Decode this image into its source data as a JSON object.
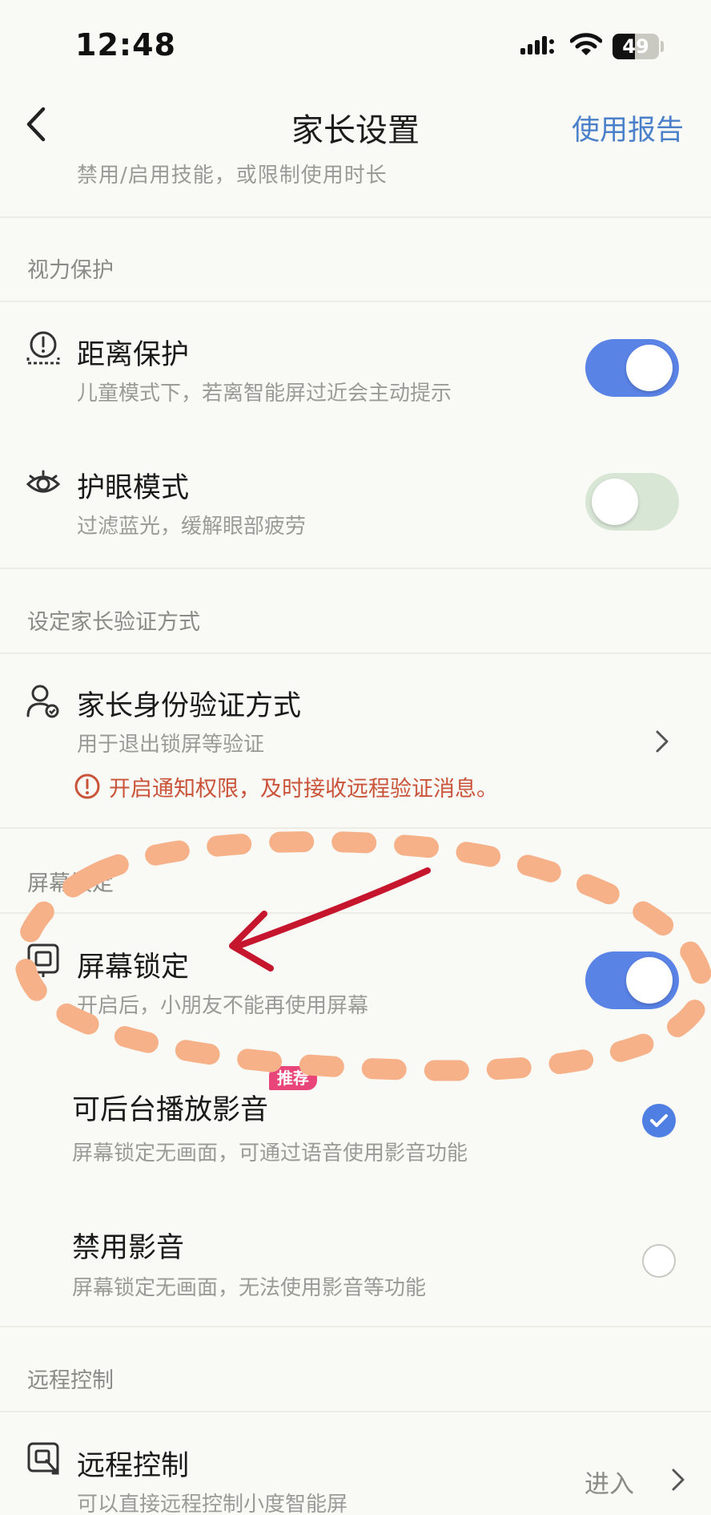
{
  "status_bar": {
    "time": "12:48",
    "battery": "49",
    "battery_level": 0.49
  },
  "nav": {
    "title": "家长设置",
    "action": "使用报告"
  },
  "cut_off_text": "禁用/启用技能，或限制使用时长",
  "vision": {
    "header": "视力保护",
    "distance": {
      "title": "距离保护",
      "subtitle": "儿童模式下，若离智能屏过近会主动提示",
      "enabled": true
    },
    "eye_care": {
      "title": "护眼模式",
      "subtitle": "过滤蓝光，缓解眼部疲劳",
      "enabled": false
    }
  },
  "verify": {
    "header": "设定家长验证方式",
    "item": {
      "title": "家长身份验证方式",
      "subtitle": "用于退出锁屏等验证",
      "warning": "开启通知权限，及时接收远程验证消息。"
    }
  },
  "screen_lock": {
    "header": "屏幕锁定",
    "lock": {
      "title": "屏幕锁定",
      "subtitle": "开启后，小朋友不能再使用屏幕",
      "enabled": true
    },
    "options": [
      {
        "title": "可后台播放影音",
        "subtitle": "屏幕锁定无画面，可通过语音使用影音功能",
        "badge": "推荐",
        "selected": true
      },
      {
        "title": "禁用影音",
        "subtitle": "屏幕锁定无画面，无法使用影音等功能",
        "selected": false
      }
    ]
  },
  "remote": {
    "header": "远程控制",
    "item": {
      "title": "远程控制",
      "subtitle": "可以直接远程控制小度智能屏",
      "action": "进入"
    }
  },
  "colors": {
    "accent": "#5a83e6",
    "link": "#4a80c9",
    "warning": "#c9543a",
    "badge": "#e8457a",
    "annotation_dash": "#f6b189",
    "annotation_arrow": "#c6162e"
  }
}
